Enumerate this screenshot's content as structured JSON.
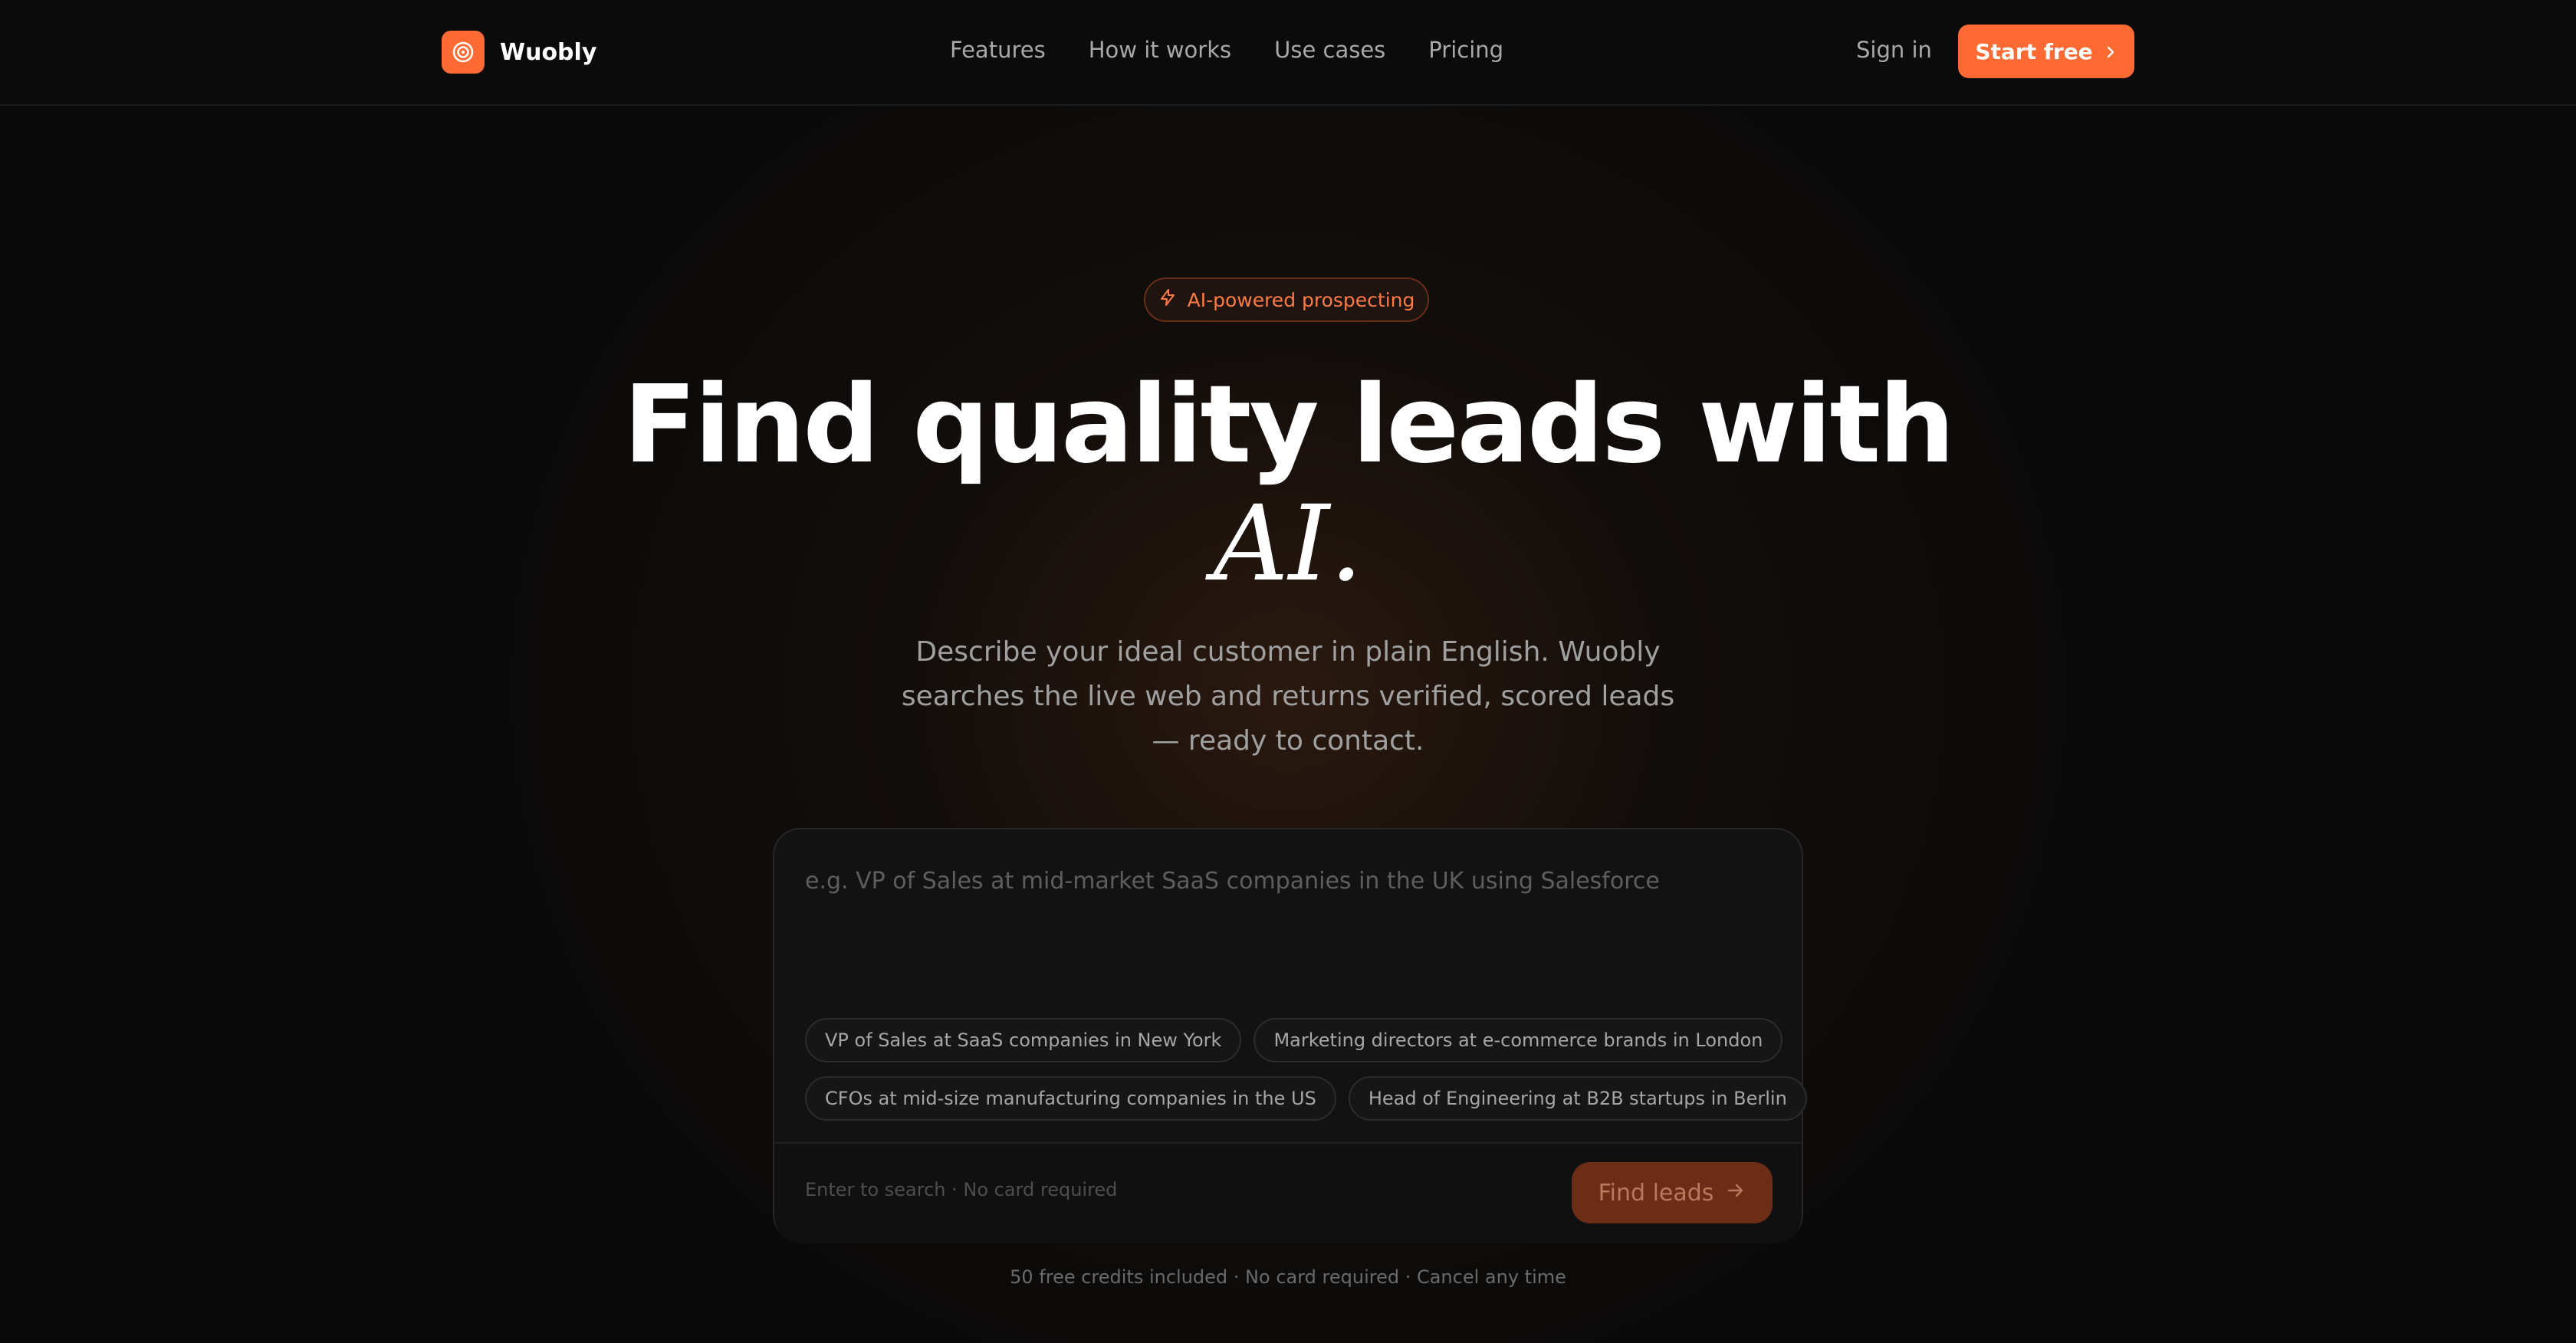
{
  "colors": {
    "accent": "#ff6a33",
    "background": "#0a0a0a",
    "badge_text": "#ff7a45",
    "find_button_bg": "#6b2d16"
  },
  "header": {
    "brand_name": "Wuobly",
    "brand_icon": "target-icon",
    "nav": [
      "Features",
      "How it works",
      "Use cases",
      "Pricing"
    ],
    "sign_in": "Sign in",
    "cta_label": "Start free",
    "cta_icon": "chevron-right-icon"
  },
  "hero": {
    "badge_icon": "lightning-icon",
    "badge_label": "AI-powered prospecting",
    "title_line1": "Find quality leads with",
    "title_line2": "AI.",
    "subtitle": "Describe your ideal customer in plain English. Wuobly searches the live web and returns verified, scored leads — ready to contact."
  },
  "search": {
    "placeholder": "e.g. VP of Sales at mid-market SaaS companies in the UK using Salesforce",
    "suggestions": [
      "VP of Sales at SaaS companies in New York",
      "Marketing directors at e-commerce brands in London",
      "CFOs at mid-size manufacturing companies in the US",
      "Head of Engineering at B2B startups in Berlin"
    ],
    "hint": "Enter to search · No card required",
    "button_label": "Find leads",
    "button_icon": "arrow-right-icon"
  },
  "footer_note": "50 free credits included · No card required · Cancel any time"
}
